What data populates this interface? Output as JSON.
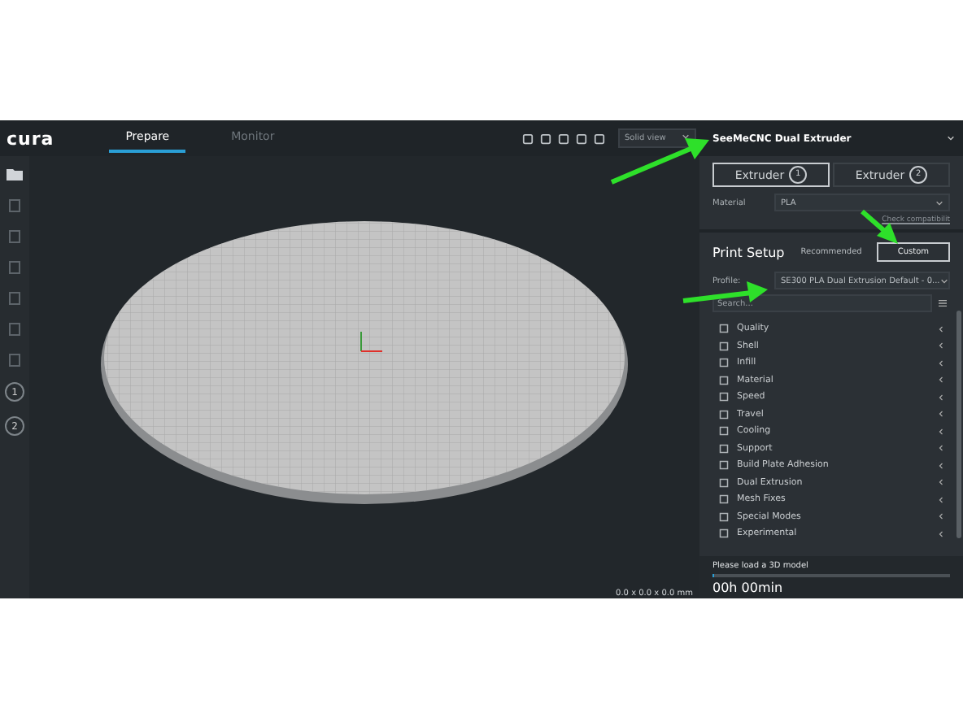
{
  "app": {
    "logo": "cura",
    "tabs": [
      {
        "label": "Prepare",
        "selected": true
      },
      {
        "label": "Monitor",
        "selected": false
      }
    ]
  },
  "view_toolbar": {
    "view_mode": "Solid view"
  },
  "left_toolbar": {
    "extruder_buttons": [
      "1",
      "2"
    ]
  },
  "viewport": {
    "dimensions": "0.0 x 0.0 x 0.0 mm"
  },
  "printer": {
    "name": "SeeMeCNC Dual Extruder",
    "extruders": [
      {
        "label": "Extruder",
        "number": "1",
        "selected": true
      },
      {
        "label": "Extruder",
        "number": "2",
        "selected": false
      }
    ],
    "material_label": "Material",
    "material": "PLA",
    "check_link": "Check compatibilit"
  },
  "print_setup": {
    "title": "Print Setup",
    "modes": [
      {
        "label": "Recommended",
        "selected": false
      },
      {
        "label": "Custom",
        "selected": true
      }
    ],
    "profile_label": "Profile:",
    "profile": "SE300 PLA Dual Extrusion Default - 0...",
    "search_placeholder": "Search...",
    "categories": [
      "Quality",
      "Shell",
      "Infill",
      "Material",
      "Speed",
      "Travel",
      "Cooling",
      "Support",
      "Build Plate Adhesion",
      "Dual Extrusion",
      "Mesh Fixes",
      "Special Modes",
      "Experimental"
    ]
  },
  "footer": {
    "status": "Please load a 3D model",
    "time": "00h 00min",
    "progress": {
      "level": 0
    }
  }
}
